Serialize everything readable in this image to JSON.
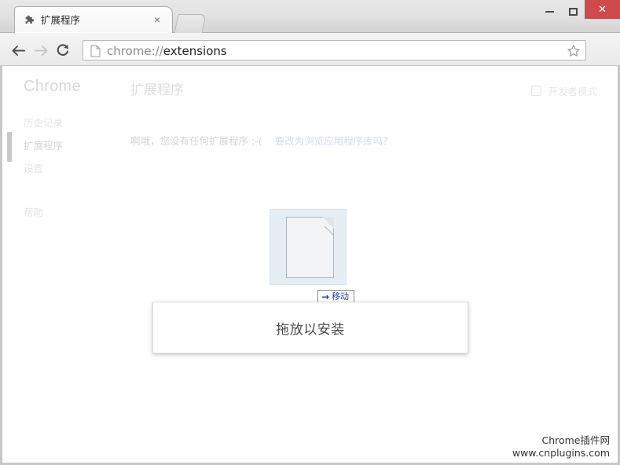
{
  "window": {
    "controls": {
      "minimize_label": "Minimize",
      "maximize_label": "Maximize",
      "close_label": "✕"
    },
    "close_color": "#cf4b4b"
  },
  "tab": {
    "title": "扩展程序",
    "favicon": "puzzle-piece-icon",
    "close_label": "×",
    "newtab_label": "+"
  },
  "toolbar": {
    "back_label": "←",
    "forward_label": "→",
    "reload_label": "↻",
    "omnibox": {
      "scheme": "chrome://",
      "path": "extensions",
      "full_url": "chrome://extensions",
      "page_icon": "document-icon",
      "star_icon": "bookmark-star-icon"
    },
    "menu_icon": "hamburger-menu-icon"
  },
  "sidebar": {
    "brand": "Chrome",
    "items": [
      {
        "label": "历史记录",
        "name": "history",
        "selected": false
      },
      {
        "label": "扩展程序",
        "name": "extensions",
        "selected": true
      },
      {
        "label": "设置",
        "name": "settings",
        "selected": false
      },
      {
        "label": "帮助",
        "name": "help",
        "selected": false
      }
    ]
  },
  "main": {
    "title": "扩展程序",
    "developer_mode": {
      "label": "开发者模式",
      "checked": false
    },
    "empty_message": "啊哦，您没有任何扩展程序 :-(",
    "empty_link": "要改为浏览应用程序库吗？"
  },
  "drag": {
    "ghost_icon": "file-document-icon",
    "tooltip_arrow": "→",
    "tooltip_label": "移动",
    "tooltip_color": "#1b3fb8"
  },
  "drop_dialog": {
    "text": "拖放以安装"
  },
  "watermark": {
    "line1": "Chrome插件网",
    "line2": "www.cnplugins.com"
  }
}
